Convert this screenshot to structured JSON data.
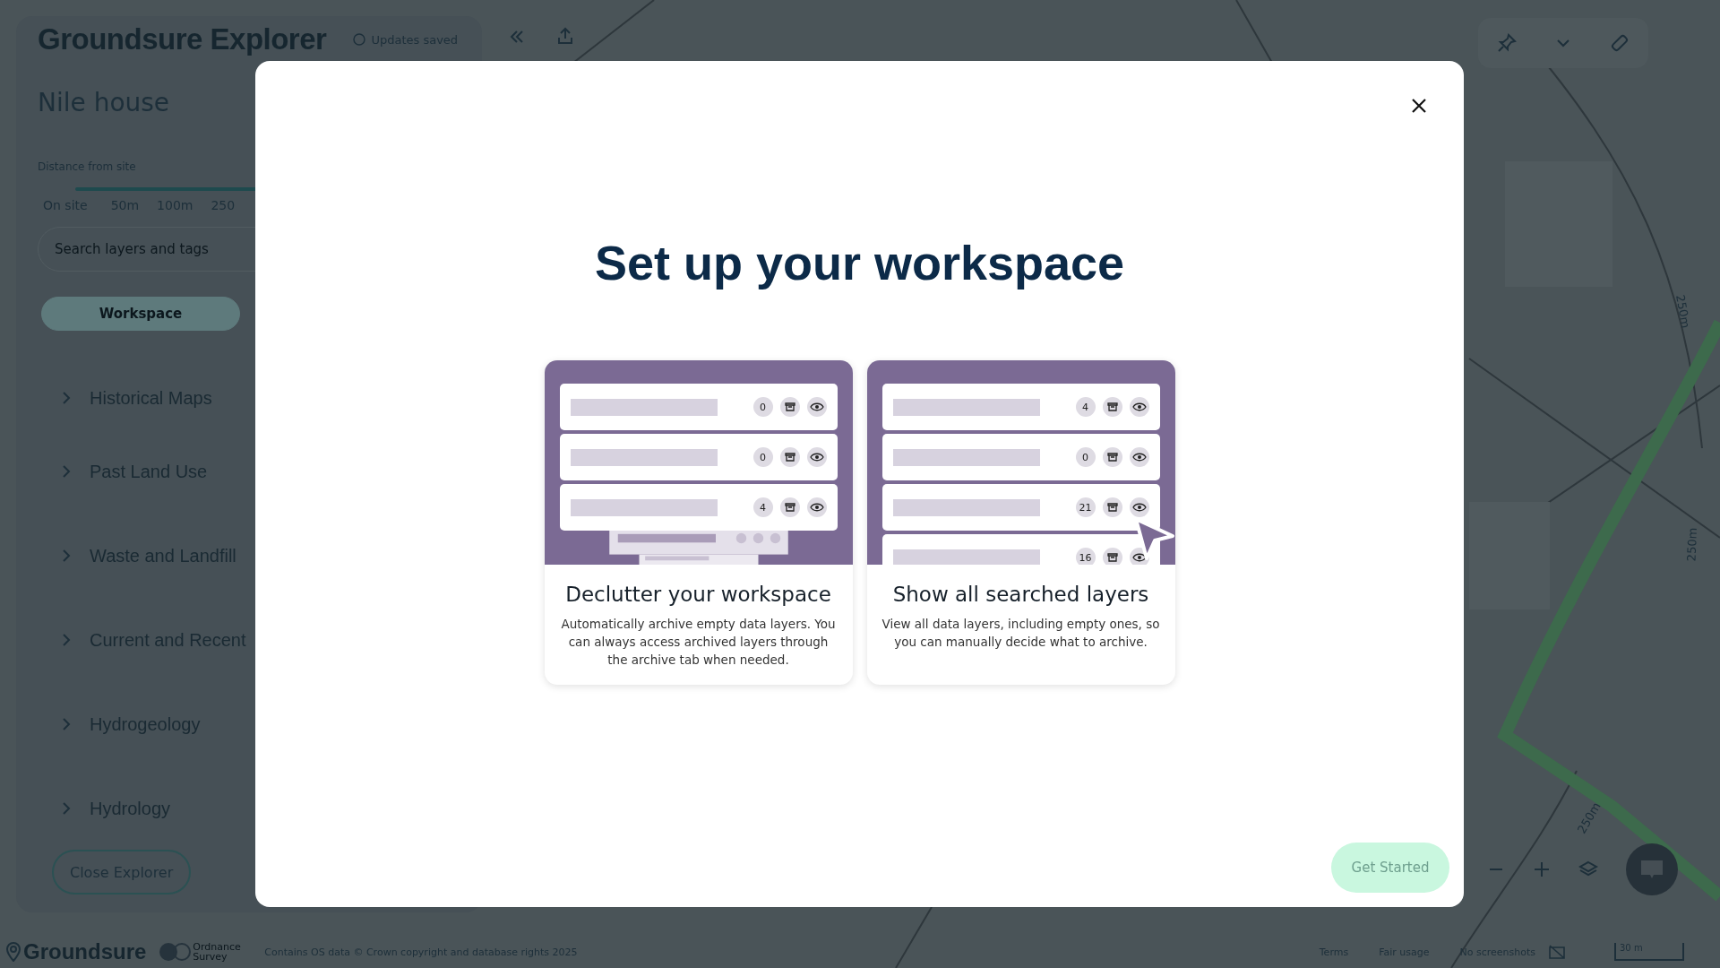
{
  "sidebar": {
    "title": "Groundsure Explorer",
    "save_status": "Updates saved",
    "site_name": "Nile house",
    "distance": {
      "label": "Distance from site",
      "ticks": [
        "On site",
        "50m",
        "100m",
        "250"
      ]
    },
    "search": {
      "placeholder": "Search layers and tags"
    },
    "tabs": [
      {
        "label": "Workspace",
        "selected": true
      }
    ],
    "categories": [
      {
        "label": "Historical Maps"
      },
      {
        "label": "Past Land Use"
      },
      {
        "label": "Waste and Landfill"
      },
      {
        "label": "Current and Recent"
      },
      {
        "label": "Hydrogeology"
      },
      {
        "label": "Hydrology"
      }
    ],
    "close_button": "Close Explorer"
  },
  "map": {
    "labels": [
      "250m",
      "250m",
      "250m"
    ],
    "scale": "30 m"
  },
  "footer": {
    "logo": "Groundsure",
    "partner": "Ordnance Survey",
    "copyright": "Contains OS data © Crown copyright and database rights 2025",
    "links": [
      "Terms",
      "Fair usage",
      "No screenshots"
    ]
  },
  "modal": {
    "title": "Set up your workspace",
    "cards": [
      {
        "kind": "declutter",
        "title": "Declutter your workspace",
        "description": "Automatically archive empty data layers. You can always access archived layers through the archive tab when needed.",
        "rows": [
          {
            "count": "0"
          },
          {
            "count": "0"
          },
          {
            "count": "4"
          }
        ]
      },
      {
        "kind": "show_all",
        "title": "Show all searched layers",
        "description": "View all data layers, including empty ones, so you can manually decide what to archive.",
        "rows": [
          {
            "count": "4"
          },
          {
            "count": "0"
          },
          {
            "count": "21"
          },
          {
            "count": "16"
          }
        ]
      }
    ],
    "button": {
      "label": "Get Started",
      "disabled": true
    }
  }
}
